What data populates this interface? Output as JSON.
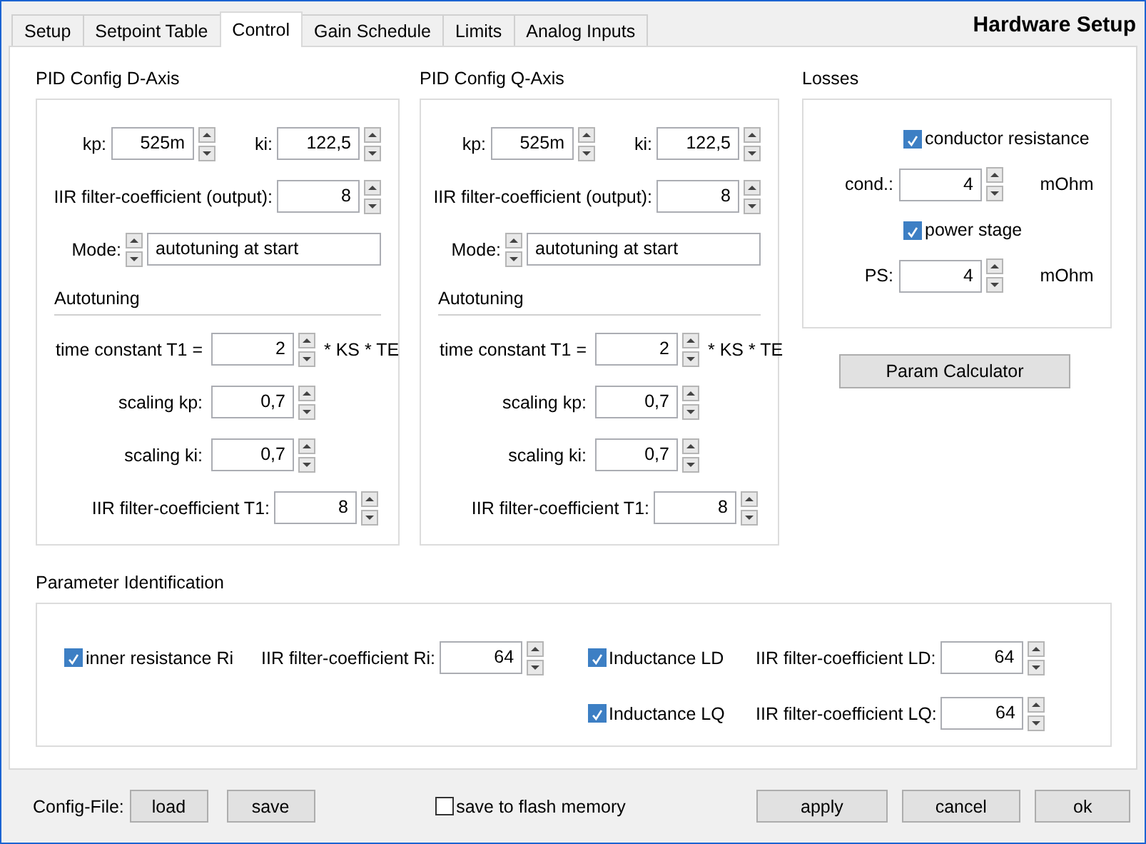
{
  "title": "Hardware Setup",
  "tabs": [
    {
      "label": "Setup",
      "selected": false
    },
    {
      "label": "Setpoint Table",
      "selected": false
    },
    {
      "label": "Control",
      "selected": true
    },
    {
      "label": "Gain Schedule",
      "selected": false
    },
    {
      "label": "Limits",
      "selected": false
    },
    {
      "label": "Analog Inputs",
      "selected": false
    }
  ],
  "pid_groups": [
    {
      "title": "PID Config D-Axis",
      "kp": {
        "label": "kp:",
        "value": "525m"
      },
      "ki": {
        "label": "ki:",
        "value": "122,5"
      },
      "iir_output": {
        "label": "IIR filter-coefficient (output):",
        "value": "8"
      },
      "mode": {
        "label": "Mode:",
        "value": "autotuning at start"
      },
      "autotuning": {
        "title": "Autotuning",
        "t1": {
          "label": "time constant T1 =",
          "value": "2",
          "unit": "* KS * TE"
        },
        "scaling_kp": {
          "label": "scaling kp:",
          "value": "0,7"
        },
        "scaling_ki": {
          "label": "scaling ki:",
          "value": "0,7"
        },
        "iir_t1": {
          "label": "IIR filter-coefficient T1:",
          "value": "8"
        }
      }
    },
    {
      "title": "PID Config Q-Axis",
      "kp": {
        "label": "kp:",
        "value": "525m"
      },
      "ki": {
        "label": "ki:",
        "value": "122,5"
      },
      "iir_output": {
        "label": "IIR filter-coefficient (output):",
        "value": "8"
      },
      "mode": {
        "label": "Mode:",
        "value": "autotuning at start"
      },
      "autotuning": {
        "title": "Autotuning",
        "t1": {
          "label": "time constant T1 =",
          "value": "2",
          "unit": "* KS * TE"
        },
        "scaling_kp": {
          "label": "scaling kp:",
          "value": "0,7"
        },
        "scaling_ki": {
          "label": "scaling ki:",
          "value": "0,7"
        },
        "iir_t1": {
          "label": "IIR filter-coefficient T1:",
          "value": "8"
        }
      }
    }
  ],
  "losses": {
    "title": "Losses",
    "items": [
      {
        "checkbox": {
          "label": "conductor resistance",
          "checked": true
        },
        "field": {
          "label": "cond.:",
          "value": "4",
          "unit": "mOhm"
        }
      },
      {
        "checkbox": {
          "label": "power stage",
          "checked": true
        },
        "field": {
          "label": "PS:",
          "value": "4",
          "unit": "mOhm"
        }
      }
    ]
  },
  "param_calculator_button": "Param Calculator",
  "parameter_identification": {
    "title": "Parameter Identification",
    "columns": [
      [
        {
          "label": "inner resistance Ri",
          "checked": true,
          "field_label": "IIR filter-coefficient Ri:",
          "value": "64"
        }
      ],
      [
        {
          "label": "Inductance LD",
          "checked": true,
          "field_label": "IIR filter-coefficient LD:",
          "value": "64"
        },
        {
          "label": "Inductance LQ",
          "checked": true,
          "field_label": "IIR filter-coefficient LQ:",
          "value": "64"
        }
      ]
    ]
  },
  "footer": {
    "config_label": "Config-File:",
    "file_buttons": [
      "load",
      "save"
    ],
    "flash": {
      "label": "save to flash memory",
      "checked": false
    },
    "action_buttons": [
      "apply",
      "cancel",
      "ok"
    ]
  }
}
